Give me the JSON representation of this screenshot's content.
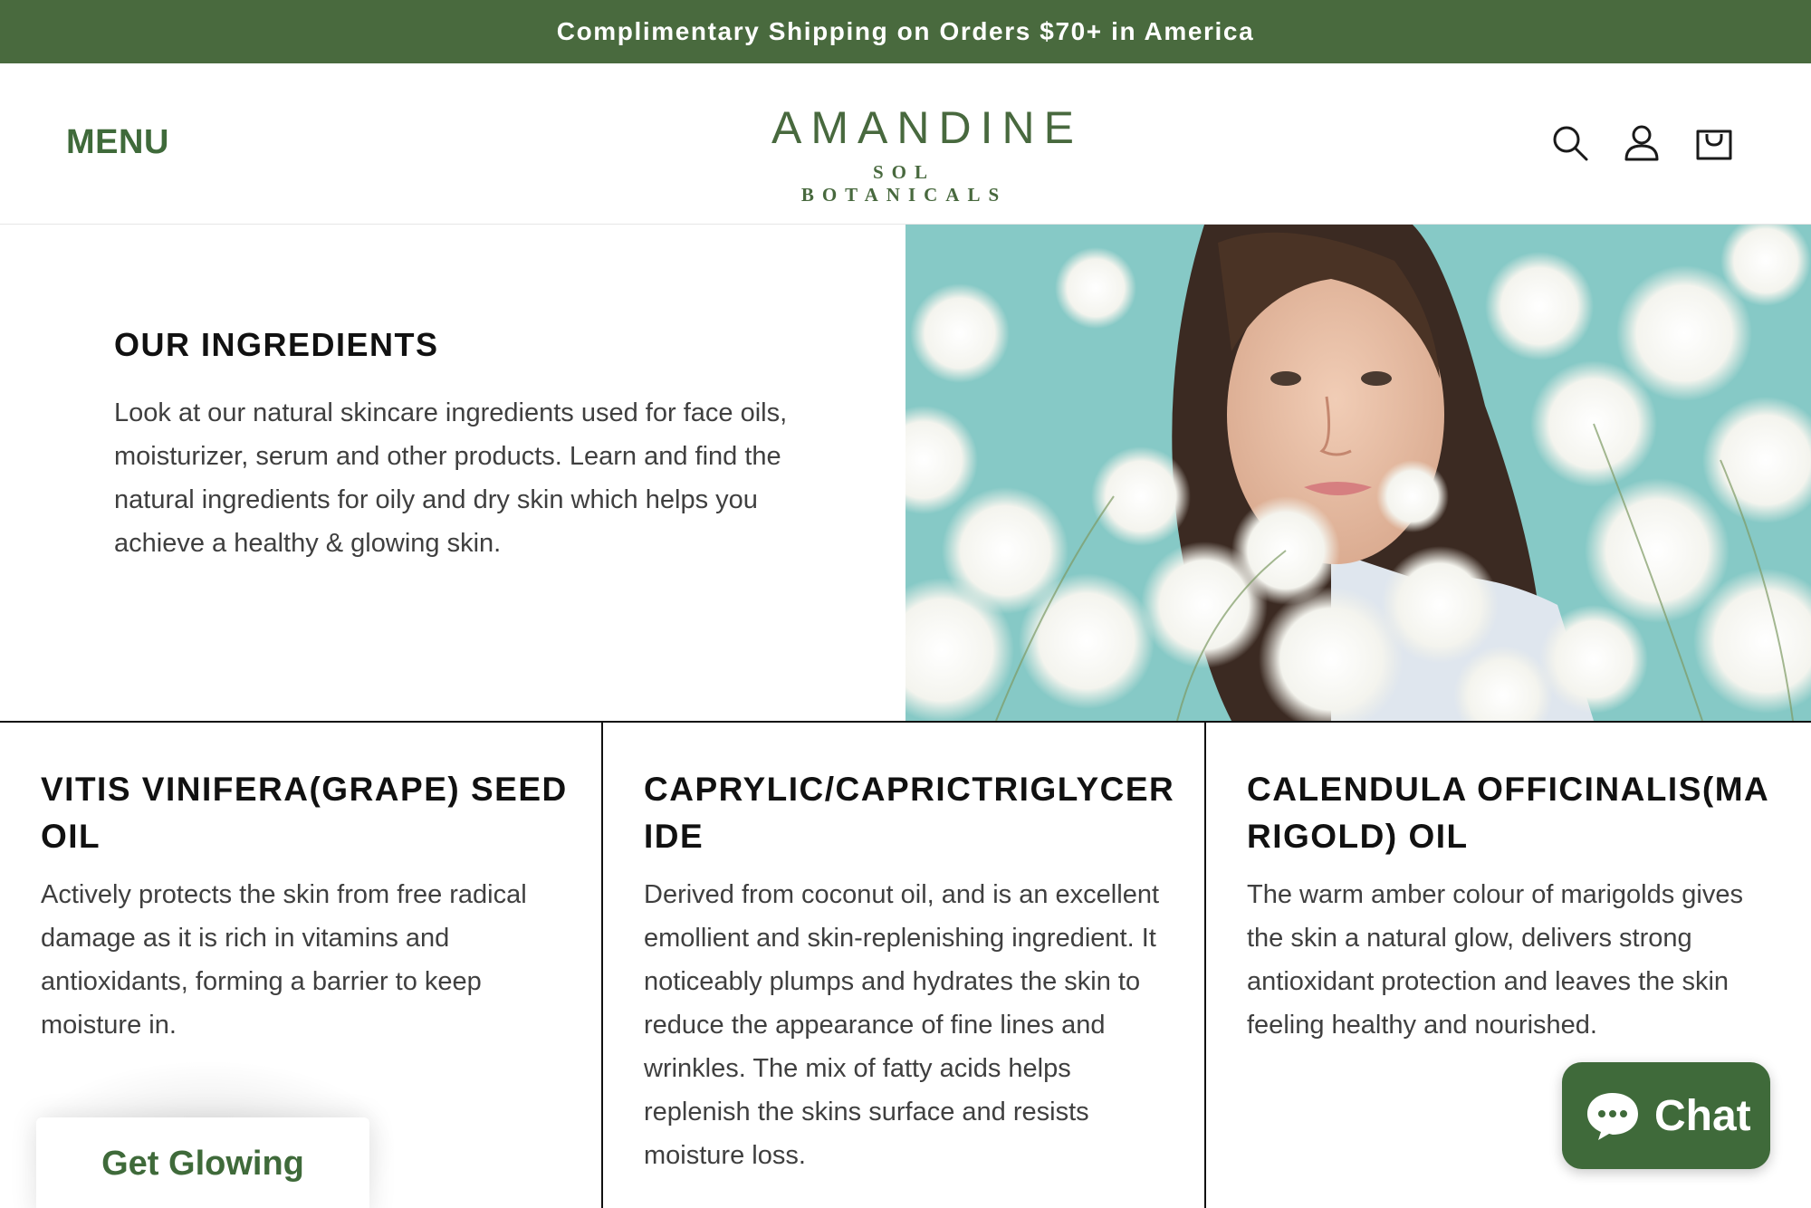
{
  "announcement": {
    "text": "Complimentary Shipping on Orders $70+ in America"
  },
  "header": {
    "menu_label": "MENU",
    "logo_main": "AMANDINE",
    "logo_sub": "SOL BOTANICALS",
    "icons": [
      "search-icon",
      "account-icon",
      "cart-icon"
    ]
  },
  "intro": {
    "title": "OUR INGREDIENTS",
    "text": "Look at our natural skincare ingredients used for face oils, moisturizer, serum and other products. Learn and find the natural ingredients for oily and dry skin which helps you achieve a healthy & glowing skin."
  },
  "ingredients": [
    {
      "name": "VITIS VINIFERA(GRAPE) SEED OIL",
      "description": "Actively protects the skin from free radical damage as it is rich in vitamins and antioxidants, forming a barrier to keep moisture in."
    },
    {
      "name": "CAPRYLIC/CAPRICTRIGLYCERIDE",
      "description": "Derived from coconut oil, and is an excellent emollient and skin-replenishing ingredient. It noticeably plumps and hydrates the skin to reduce the appearance of fine lines and wrinkles. The mix of fatty acids helps replenish the skins surface and resists moisture loss."
    },
    {
      "name": "CALENDULA OFFICINALIS(MARIGOLD) OIL",
      "description": "The warm amber colour of marigolds gives the skin a natural glow, delivers strong antioxidant protection and leaves the skin feeling healthy and nourished."
    }
  ],
  "floating": {
    "glow_label": "Get Glowing",
    "chat_label": "Chat"
  },
  "colors": {
    "brand_green": "#496a3e",
    "text_dark": "#111111",
    "text_body": "#3f3f3f"
  }
}
